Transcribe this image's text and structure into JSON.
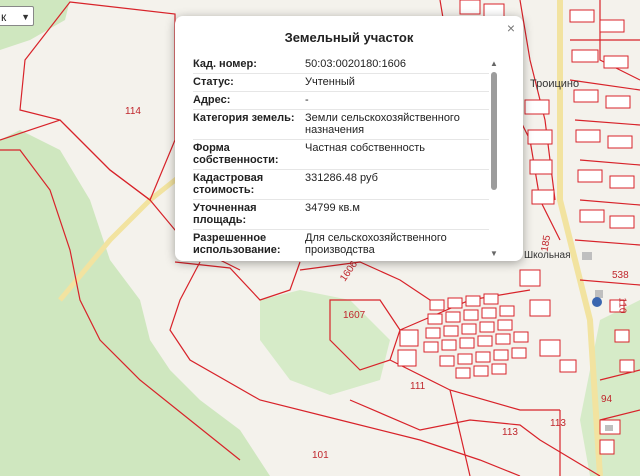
{
  "map": {
    "labels": {
      "p114": "114",
      "p1607": "1607",
      "p1606": "1606",
      "p111": "111",
      "p113a": "113",
      "p113b": "113",
      "p101": "101",
      "p185": "185",
      "p538": "538",
      "p110": "110",
      "p94": "94",
      "village_troitsino": "Троицино",
      "school_street": "Школьная"
    }
  },
  "layer_select": {
    "value": "к"
  },
  "popup": {
    "title": "Земельный участок",
    "close_label": "×",
    "rows": [
      {
        "key": "Кад. номер:",
        "value": "50:03:0020180:1606"
      },
      {
        "key": "Статус:",
        "value": "Учтенный"
      },
      {
        "key": "Адрес:",
        "value": "-"
      },
      {
        "key": "Категория земель:",
        "value": "Земли сельскохозяйственного назначения"
      },
      {
        "key": "Форма собственности:",
        "value": "Частная собственность"
      },
      {
        "key": "Кадастровая стоимость:",
        "value": "331286.48 руб"
      },
      {
        "key": "Уточненная площадь:",
        "value": "34799 кв.м"
      },
      {
        "key": "Разрешенное использование:",
        "value": "Для сельскохозяйственного производства"
      }
    ]
  },
  "colors": {
    "parcel_border": "#d8232a",
    "forest": "#cfe8c0",
    "field": "#f7f5ef",
    "road": "#f6e9a8"
  }
}
